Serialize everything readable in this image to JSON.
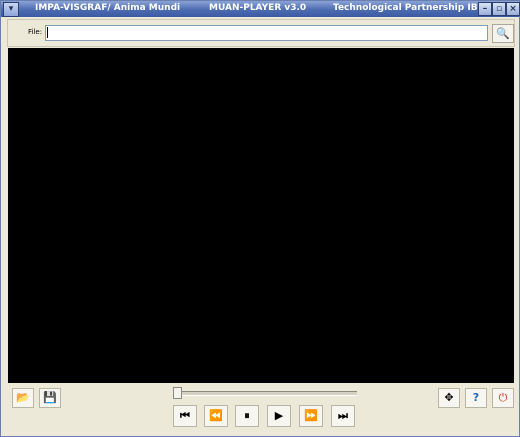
{
  "titlebar": {
    "left": "IMPA-VISGRAF/ Anima Mundi",
    "center": "MUAN-PLAYER v3.0",
    "right": "Technological Partnership IBM"
  },
  "file": {
    "label": "File:",
    "value": ""
  },
  "playback": {
    "position_fraction": 0.0
  },
  "icons": {
    "menu": "▾",
    "minimize": "–",
    "maximize": "▫",
    "close": "×",
    "browse": "🔍",
    "open": "📂",
    "save": "💾",
    "fullscreen": "✥",
    "help": "?",
    "exit": "⏻",
    "skip_start": "⏮",
    "step_back": "⏪",
    "pause": "⏸",
    "play": "▶",
    "step_forward": "⏩",
    "skip_end": "⏭"
  }
}
